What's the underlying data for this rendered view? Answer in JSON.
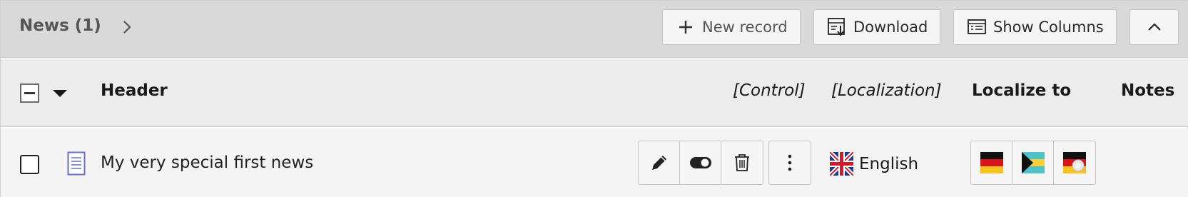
{
  "titlebar": {
    "title": "News (1)",
    "new_record": "New record",
    "download": "Download",
    "show_columns": "Show Columns"
  },
  "header_row": {
    "header": "Header",
    "control": "[Control]",
    "localization": "[Localization]",
    "localize_to": "Localize to",
    "notes": "Notes"
  },
  "rows": [
    {
      "title": "My very special first news",
      "language": "English",
      "localize_to_flags": [
        "de-flag",
        "bs-flag",
        "de-flag-badge"
      ]
    }
  ],
  "colors": {
    "titlebar_bg": "#d9d9d9",
    "header_bg": "#ececec",
    "row_bg": "#f4f4f4",
    "doc_icon": "#6c6fc9"
  }
}
